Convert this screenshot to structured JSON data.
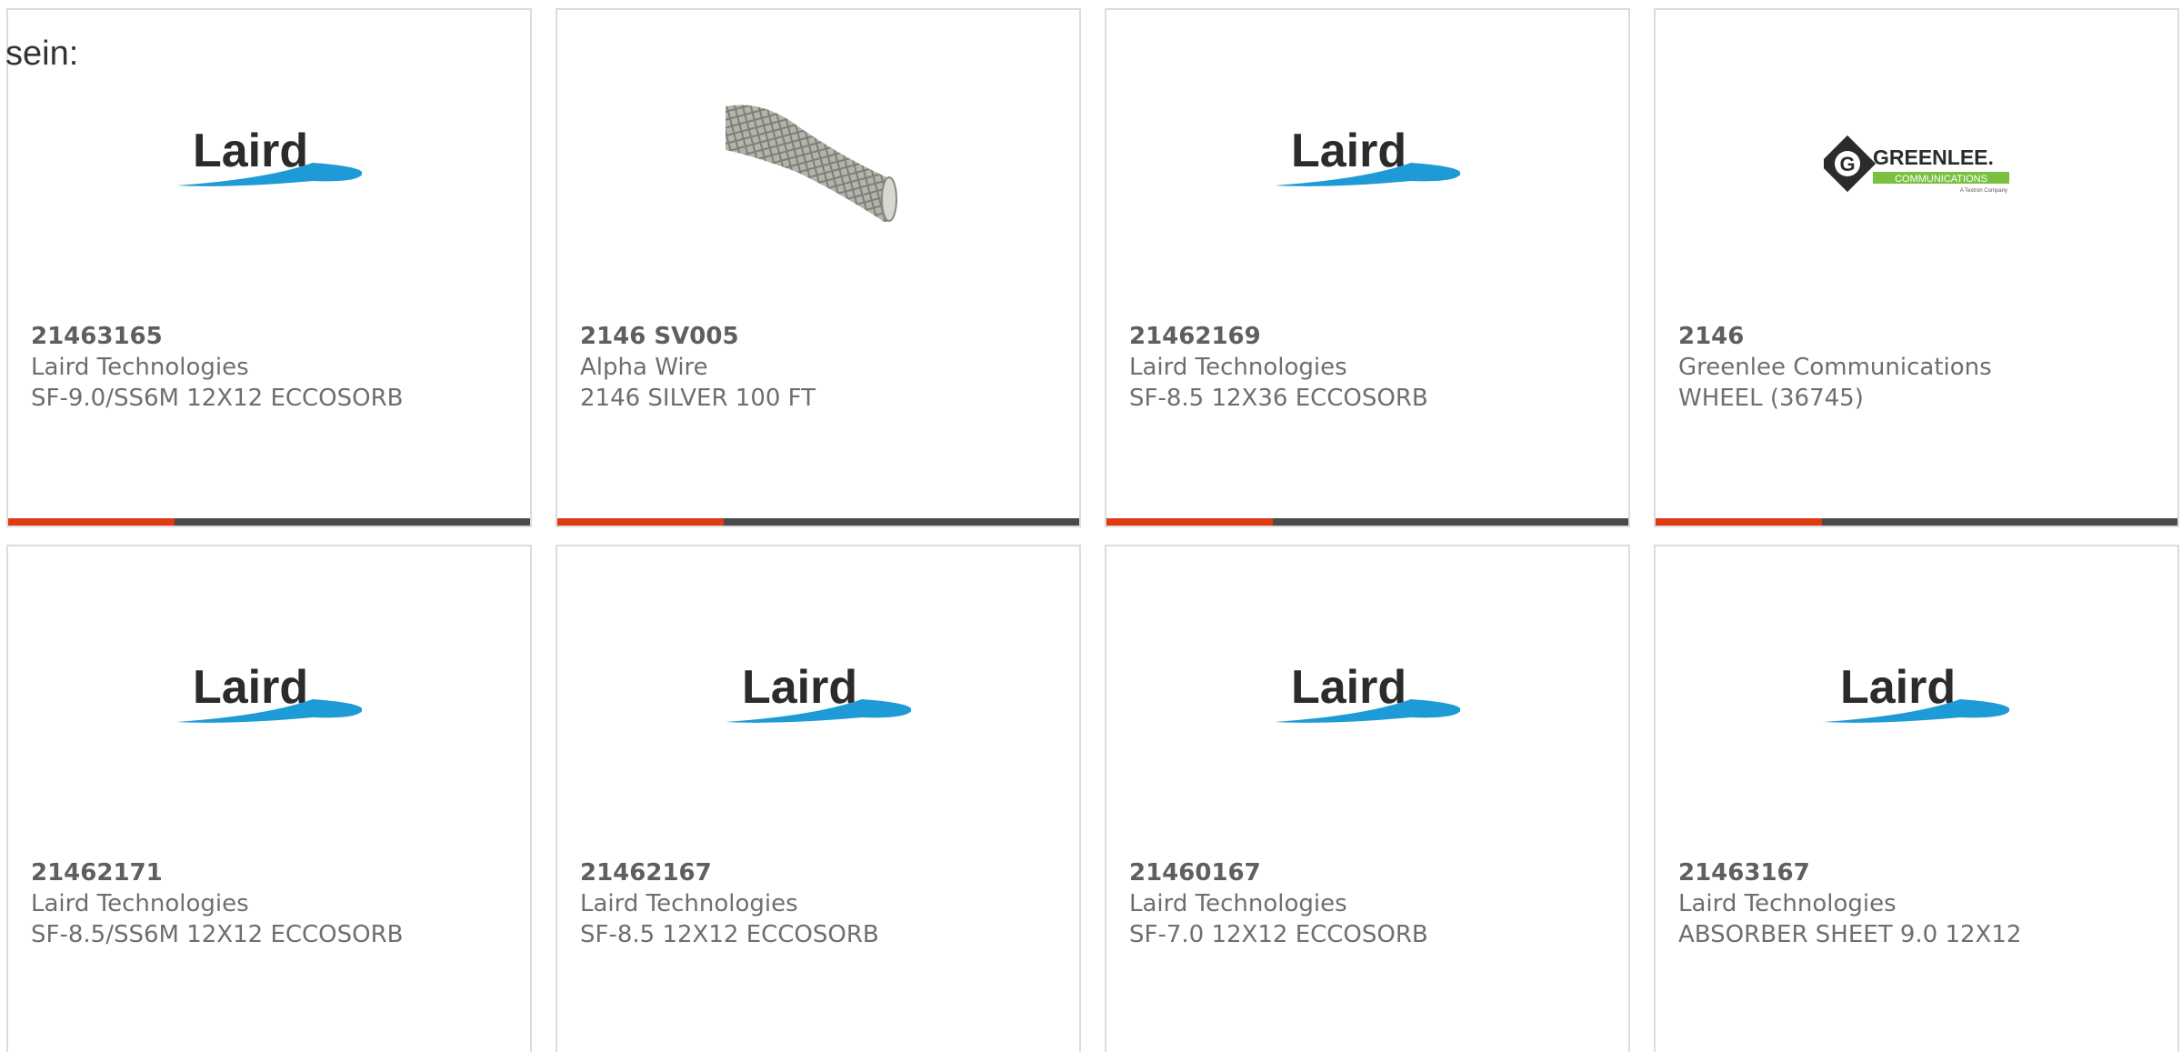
{
  "lead_text": "sein:",
  "colors": {
    "accent": "#e03a12",
    "bar": "#4a4a4a",
    "laird_blue": "#1e9ad6",
    "greenlee_green": "#7ac143"
  },
  "products": [
    {
      "part_number": "21463165",
      "manufacturer": "Laird Technologies",
      "description": "SF-9.0/SS6M 12X12 ECCOSORB",
      "image": "laird-logo",
      "logo_text": "Laird"
    },
    {
      "part_number": "2146 SV005",
      "manufacturer": "Alpha Wire",
      "description": "2146 SILVER 100 FT",
      "image": "braided-sleeve-photo"
    },
    {
      "part_number": "21462169",
      "manufacturer": "Laird Technologies",
      "description": "SF-8.5 12X36 ECCOSORB",
      "image": "laird-logo",
      "logo_text": "Laird"
    },
    {
      "part_number": "2146",
      "manufacturer": "Greenlee Communications",
      "description": "WHEEL (36745)",
      "image": "greenlee-logo",
      "logo_text": "GREENLEE.",
      "logo_sub": "COMMUNICATIONS",
      "logo_tag": "A Textron Company"
    },
    {
      "part_number": "21462171",
      "manufacturer": "Laird Technologies",
      "description": "SF-8.5/SS6M 12X12 ECCOSORB",
      "image": "laird-logo",
      "logo_text": "Laird"
    },
    {
      "part_number": "21462167",
      "manufacturer": "Laird Technologies",
      "description": "SF-8.5 12X12 ECCOSORB",
      "image": "laird-logo",
      "logo_text": "Laird"
    },
    {
      "part_number": "21460167",
      "manufacturer": "Laird Technologies",
      "description": "SF-7.0 12X12 ECCOSORB",
      "image": "laird-logo",
      "logo_text": "Laird"
    },
    {
      "part_number": "21463167",
      "manufacturer": "Laird Technologies",
      "description": "ABSORBER SHEET 9.0 12X12",
      "image": "laird-logo",
      "logo_text": "Laird"
    }
  ]
}
